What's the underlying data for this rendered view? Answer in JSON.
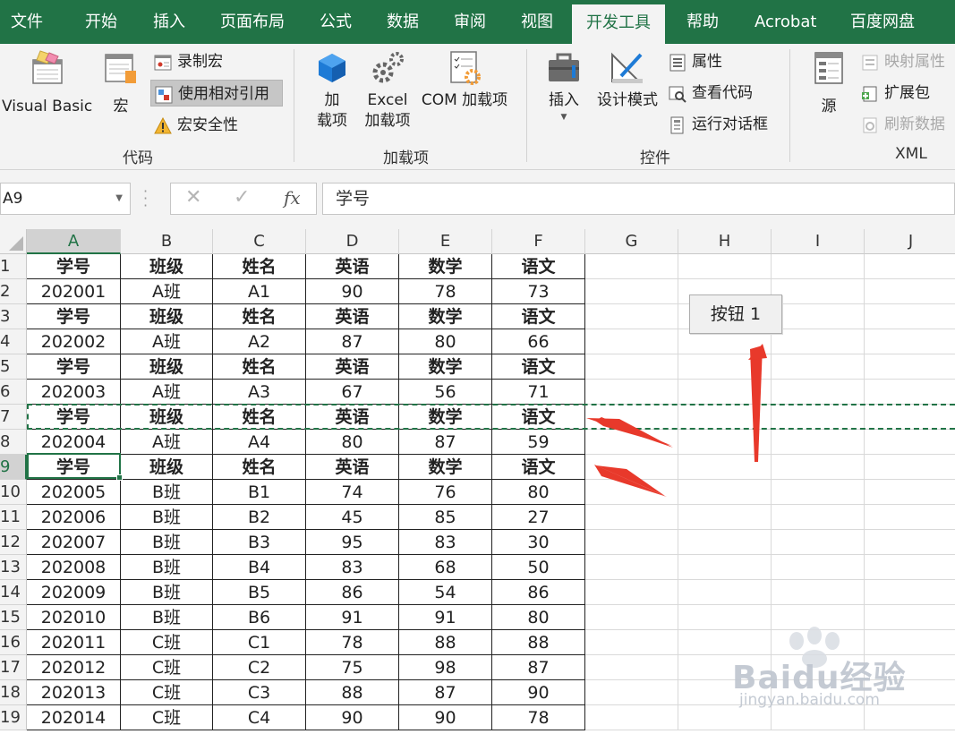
{
  "menu": {
    "tabs": [
      "文件",
      "开始",
      "插入",
      "页面布局",
      "公式",
      "数据",
      "审阅",
      "视图",
      "开发工具",
      "帮助",
      "Acrobat",
      "百度网盘"
    ],
    "active": "开发工具"
  },
  "ribbon": {
    "code": {
      "label": "代码",
      "visual_basic": "Visual Basic",
      "macros": "宏",
      "record_macro": "录制宏",
      "use_relative": "使用相对引用",
      "macro_security": "宏安全性"
    },
    "addins": {
      "label": "加载项",
      "addins_line1": "加",
      "addins_line2": "载项",
      "excel_addins_line1": "Excel",
      "excel_addins_line2": "加载项",
      "com_addins": "COM 加载项"
    },
    "controls": {
      "label": "控件",
      "insert": "插入",
      "design_mode": "设计模式",
      "properties": "属性",
      "view_code": "查看代码",
      "run_dialog": "运行对话框"
    },
    "xml": {
      "label": "XML",
      "source": "源",
      "map_properties": "映射属性",
      "expansion_packs": "扩展包",
      "refresh_data": "刷新数据"
    }
  },
  "formula_bar": {
    "name_box": "A9",
    "formula": "学号"
  },
  "sheet": {
    "columns": [
      "A",
      "B",
      "C",
      "D",
      "E",
      "F",
      "G",
      "H",
      "I",
      "J"
    ],
    "row_numbers": [
      "1",
      "2",
      "3",
      "4",
      "5",
      "6",
      "7",
      "8",
      "9",
      "10",
      "11",
      "12",
      "13",
      "14",
      "15",
      "16",
      "17",
      "18",
      "19"
    ],
    "rows": [
      [
        "学号",
        "班级",
        "姓名",
        "英语",
        "数学",
        "语文"
      ],
      [
        "202001",
        "A班",
        "A1",
        "90",
        "78",
        "73"
      ],
      [
        "学号",
        "班级",
        "姓名",
        "英语",
        "数学",
        "语文"
      ],
      [
        "202002",
        "A班",
        "A2",
        "87",
        "80",
        "66"
      ],
      [
        "学号",
        "班级",
        "姓名",
        "英语",
        "数学",
        "语文"
      ],
      [
        "202003",
        "A班",
        "A3",
        "67",
        "56",
        "71"
      ],
      [
        "学号",
        "班级",
        "姓名",
        "英语",
        "数学",
        "语文"
      ],
      [
        "202004",
        "A班",
        "A4",
        "80",
        "87",
        "59"
      ],
      [
        "学号",
        "班级",
        "姓名",
        "英语",
        "数学",
        "语文"
      ],
      [
        "202005",
        "B班",
        "B1",
        "74",
        "76",
        "80"
      ],
      [
        "202006",
        "B班",
        "B2",
        "45",
        "85",
        "27"
      ],
      [
        "202007",
        "B班",
        "B3",
        "95",
        "83",
        "30"
      ],
      [
        "202008",
        "B班",
        "B4",
        "83",
        "68",
        "50"
      ],
      [
        "202009",
        "B班",
        "B5",
        "86",
        "54",
        "86"
      ],
      [
        "202010",
        "B班",
        "B6",
        "91",
        "91",
        "80"
      ],
      [
        "202011",
        "C班",
        "C1",
        "78",
        "88",
        "88"
      ],
      [
        "202012",
        "C班",
        "C2",
        "75",
        "98",
        "87"
      ],
      [
        "202013",
        "C班",
        "C3",
        "88",
        "87",
        "90"
      ],
      [
        "202014",
        "C班",
        "C4",
        "90",
        "90",
        "78"
      ]
    ],
    "selected_cell": "A9",
    "button_label": "按钮 1"
  },
  "watermark": {
    "brand": "Baidu经验",
    "url": "jingyan.baidu.com"
  },
  "colors": {
    "accent": "#217346",
    "arrow": "#e8392b"
  }
}
